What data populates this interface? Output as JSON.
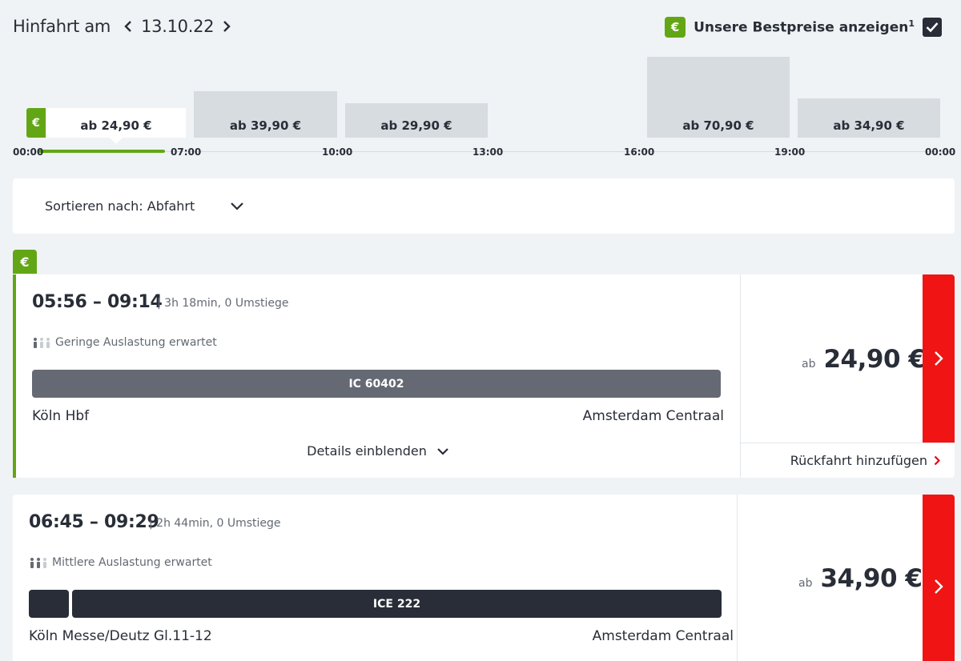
{
  "header": {
    "title": "Hinfahrt am",
    "date": "13.10.22",
    "bestprice_label": "Unsere Bestpreise anzeigen",
    "bestprice_sup": "1",
    "bestprice_checked": true,
    "euro_symbol": "€"
  },
  "histogram": {
    "bars": [
      {
        "label": "ab 24,90 €",
        "level": 0.37,
        "active": true
      },
      {
        "label": "ab 39,90 €",
        "level": 0.57,
        "active": false
      },
      {
        "label": "ab 29,90 €",
        "level": 0.43,
        "active": false
      },
      {
        "label": "",
        "level": 0,
        "active": false
      },
      {
        "label": "ab 70,90 €",
        "level": 1.0,
        "active": false
      },
      {
        "label": "ab 34,90 €",
        "level": 0.49,
        "active": false
      }
    ],
    "ticks": [
      "00:00",
      "07:00",
      "10:00",
      "13:00",
      "16:00",
      "19:00",
      "00:00"
    ]
  },
  "sort": {
    "label": "Sortieren nach: Abfahrt"
  },
  "connections": [
    {
      "time": "05:56 – 09:14",
      "duration": "| 3h 18min, 0 Umstiege",
      "load": "Geringe Auslastung erwartet",
      "train": "IC 60402",
      "from": "Köln Hbf",
      "to": "Amsterdam Centraal",
      "details": "Details einblenden",
      "price_ab": "ab",
      "price": "24,90 €",
      "return_label": "Rückfahrt hinzufügen",
      "best": true
    },
    {
      "time": "06:45 – 09:29",
      "duration": "| 2h 44min, 0 Umstiege",
      "load": "Mittlere Auslastung erwartet",
      "train": "ICE 222",
      "from": "Köln Messe/Deutz Gl.11-12",
      "to": "Amsterdam Centraal",
      "price_ab": "ab",
      "price": "34,90 €",
      "best": false
    }
  ],
  "colors": {
    "green": "#63a615",
    "red": "#f01414",
    "ic_bar": "#646973",
    "ice_bar": "#282d37"
  }
}
